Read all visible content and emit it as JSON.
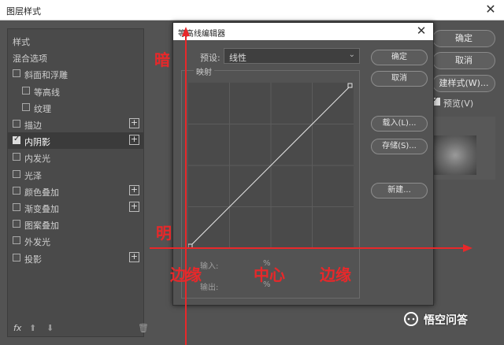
{
  "window": {
    "title": "图层样式",
    "close": "✕"
  },
  "style_list": {
    "items": [
      {
        "label": "样式",
        "checkbox": false,
        "plus": false,
        "indent": 0,
        "top": 0
      },
      {
        "label": "混合选项",
        "checkbox": false,
        "plus": false,
        "indent": 0
      },
      {
        "label": "斜面和浮雕",
        "checkbox": true,
        "checked": false,
        "plus": false,
        "indent": 0
      },
      {
        "label": "等高线",
        "checkbox": true,
        "checked": false,
        "plus": false,
        "indent": 1
      },
      {
        "label": "纹理",
        "checkbox": true,
        "checked": false,
        "plus": false,
        "indent": 1
      },
      {
        "label": "描边",
        "checkbox": true,
        "checked": false,
        "plus": true,
        "indent": 0
      },
      {
        "label": "内阴影",
        "checkbox": true,
        "checked": true,
        "plus": true,
        "indent": 0,
        "selected": true
      },
      {
        "label": "内发光",
        "checkbox": true,
        "checked": false,
        "plus": false,
        "indent": 0
      },
      {
        "label": "光泽",
        "checkbox": true,
        "checked": false,
        "plus": false,
        "indent": 0
      },
      {
        "label": "颜色叠加",
        "checkbox": true,
        "checked": false,
        "plus": true,
        "indent": 0
      },
      {
        "label": "渐变叠加",
        "checkbox": true,
        "checked": false,
        "plus": true,
        "indent": 0
      },
      {
        "label": "图案叠加",
        "checkbox": true,
        "checked": false,
        "plus": false,
        "indent": 0
      },
      {
        "label": "外发光",
        "checkbox": true,
        "checked": false,
        "plus": false,
        "indent": 0
      },
      {
        "label": "投影",
        "checkbox": true,
        "checked": false,
        "plus": true,
        "indent": 0
      }
    ],
    "footer": {
      "fx": "fx",
      "up": "⬆",
      "down": "⬇",
      "trash": "🗑"
    }
  },
  "right_panel": {
    "ok": "确定",
    "cancel": "取消",
    "new_style": "建样式(W)...",
    "preview": "预览(V)"
  },
  "contour_editor": {
    "title": "等高线编辑器",
    "close": "✕",
    "preset_label": "预设:",
    "preset_value": "线性",
    "mapping_label": "映射",
    "input_label": "输入:",
    "output_label": "输出:",
    "input_value": "%",
    "output_value": "%",
    "buttons": {
      "ok": "确定",
      "cancel": "取消",
      "load": "载入(L)...",
      "save": "存储(S)...",
      "new": "新建..."
    }
  },
  "annotations": {
    "dark": "暗",
    "bright": "明",
    "edge_left": "边缘",
    "center": "中心",
    "edge_right": "边缘",
    "color": "#e8282a"
  },
  "watermark": "悟空问答"
}
